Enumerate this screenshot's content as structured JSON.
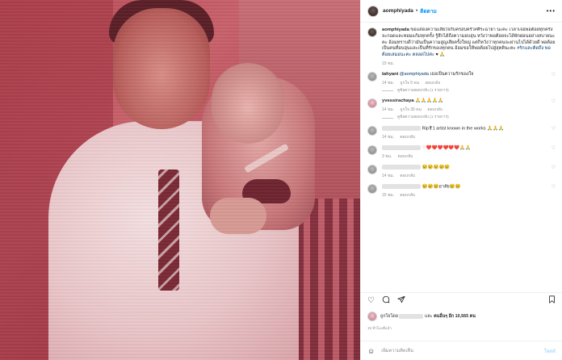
{
  "post": {
    "author": "aomphiyada",
    "follow_label": "ติดตาม",
    "more": "•••"
  },
  "caption": {
    "author": "aomphiyada",
    "text": "ขอแสดงความเสียใจกับครอบครัว#ศีระฉายา นะคะ เวลาเจอพ่อต้อยทุกครั้งจะกอดและหอมแก้มทุกครั้ง รู้สึกได้ถึงความอบอุ่น หวังว่าพ่อต้อยจะได้พักผ่อนอย่างสบายนะคะ อ้อมทราบดีว่ามันเป็นความสูญเสียครั้งใหญ่ แต่ก็หวังว่าทุกคนจะผ่านไปได้ด้วยดี พ่อต้อยเป็นคนที่อบอุ่นและเป็นที่รักของทุกคน อ้อมขอให้พ่อต้อยไปสู่สุคตินะคะ",
    "hashtags": "#รักและคิดถึง พ่อต้อยเสมอนะคะ ตลอดไปค่ะ",
    "hearts": "♥ 🙏",
    "time": "15 ชม."
  },
  "comments": [
    {
      "author": "tahyani",
      "mention": "@aomphiyada",
      "text": "เธอเป็นความรักของใจ",
      "time": "14 ชม.",
      "likes": "ถูกใจ 5 คน",
      "reply": "ตอบกลับ",
      "replies": "ดูข้อความตอบกลับ (1 รายการ)"
    },
    {
      "author": "yvessirachaya",
      "mention": "",
      "text": "🙏🙏🙏🙏🙏",
      "time": "14 ชม.",
      "likes": "ถูกใจ 30 คน",
      "reply": "ตอบกลับ",
      "replies": "ดูข้อความตอบกลับ (1 รายการ)"
    },
    {
      "author": "",
      "mention": "",
      "text": "Rip❣1 artist known in the works 🙏🙏🙏",
      "time": "14 ชม.",
      "likes": "",
      "reply": "ตอบกลับ",
      "replies": ""
    },
    {
      "author": "",
      "mention": "",
      "text": "♡❤️❤️❤️❤️❤️❤️🙏🙏",
      "time": "3 ชม.",
      "likes": "",
      "reply": "ตอบกลับ",
      "replies": ""
    },
    {
      "author": "",
      "mention": "",
      "text": "😢😢😢😢😢",
      "time": "14 ชม.",
      "likes": "",
      "reply": "ตอบกลับ",
      "replies": ""
    },
    {
      "author": "",
      "mention": "",
      "text": "😢😢😢อาลัย😢😢",
      "time": "15 ชม.",
      "likes": "",
      "reply": "ตอบกลับ",
      "replies": ""
    }
  ],
  "actions": {
    "like_icon": "heart-outline-icon",
    "comment_icon": "speech-bubble-icon",
    "share_icon": "paper-plane-icon",
    "save_icon": "bookmark-icon"
  },
  "liked_by": {
    "prefix": "ถูกใจโดย",
    "and": "และ",
    "others": "คนอื่นๆ อีก 10,565 คน"
  },
  "post_time": "15 ชั่วโมงที่แล้ว",
  "add_comment": {
    "placeholder": "เพิ่มความคิดเห็น",
    "post_label": "โพสต์"
  },
  "colors": {
    "link": "#0095f6",
    "muted": "#8e8e8e",
    "photo_tint": "#b84a55"
  }
}
